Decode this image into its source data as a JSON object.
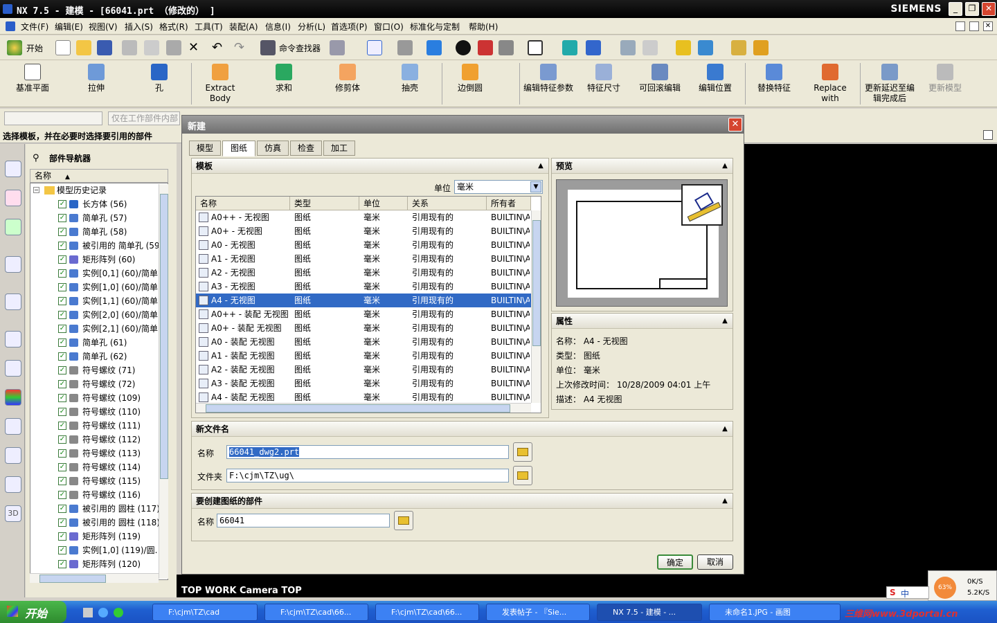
{
  "window": {
    "title": "NX 7.5 - 建模 - [66041.prt （修改的） ]",
    "brand": "SIEMENS"
  },
  "menu": [
    "文件(F)",
    "编辑(E)",
    "视图(V)",
    "插入(S)",
    "格式(R)",
    "工具(T)",
    "装配(A)",
    "信息(I)",
    "分析(L)",
    "首选项(P)",
    "窗口(O)",
    "标准化与定制",
    "帮助(H)"
  ],
  "toolbar1": {
    "start_label": "开始",
    "finder_label": "命令查找器"
  },
  "toolbar2": [
    "基准平面",
    "拉伸",
    "孔",
    "Extract Body",
    "求和",
    "修剪体",
    "抽壳",
    "边倒圆",
    "编辑特征参数",
    "特征尺寸",
    "可回滚编辑",
    "编辑位置",
    "替换特征",
    "Replace with",
    "更新延迟至编辑完成后",
    "更新模型"
  ],
  "filter": {
    "placeholder": "仅在工作部件内部"
  },
  "status": "选择模板，并在必要时选择要引用的部件",
  "navigator": {
    "title": "部件导航器",
    "col_name": "名称",
    "root": "模型历史记录",
    "items": [
      "长方体 (56)",
      "简单孔 (57)",
      "简单孔 (58)",
      "被引用的 简单孔 (59",
      "矩形阵列 (60)",
      "实例[0,1] (60)/简单.",
      "实例[1,0] (60)/简单.",
      "实例[1,1] (60)/简单.",
      "实例[2,0] (60)/简单.",
      "实例[2,1] (60)/简单.",
      "简单孔 (61)",
      "简单孔 (62)",
      "符号螺纹 (71)",
      "符号螺纹 (72)",
      "符号螺纹 (109)",
      "符号螺纹 (110)",
      "符号螺纹 (111)",
      "符号螺纹 (112)",
      "符号螺纹 (113)",
      "符号螺纹 (114)",
      "符号螺纹 (115)",
      "符号螺纹 (116)",
      "被引用的 圆柱 (117)",
      "被引用的 圆柱 (118)",
      "矩形阵列 (119)",
      "实例[1,0] (119)/圆.",
      "矩形阵列 (120)"
    ]
  },
  "dialog": {
    "title": "新建",
    "tabs": [
      "模型",
      "图纸",
      "仿真",
      "检查",
      "加工"
    ],
    "template": {
      "header": "模板",
      "unit_label": "单位",
      "unit_value": "毫米",
      "columns": [
        "名称",
        "类型",
        "单位",
        "关系",
        "所有者"
      ],
      "rows": [
        [
          "A0++ - 无视图",
          "图纸",
          "毫米",
          "引用现有的",
          "BUILTIN\\A"
        ],
        [
          "A0+ - 无视图",
          "图纸",
          "毫米",
          "引用现有的",
          "BUILTIN\\A"
        ],
        [
          "A0 - 无视图",
          "图纸",
          "毫米",
          "引用现有的",
          "BUILTIN\\A"
        ],
        [
          "A1 - 无视图",
          "图纸",
          "毫米",
          "引用现有的",
          "BUILTIN\\A"
        ],
        [
          "A2 - 无视图",
          "图纸",
          "毫米",
          "引用现有的",
          "BUILTIN\\A"
        ],
        [
          "A3 - 无视图",
          "图纸",
          "毫米",
          "引用现有的",
          "BUILTIN\\A"
        ],
        [
          "A4 - 无视图",
          "图纸",
          "毫米",
          "引用现有的",
          "BUILTIN\\A"
        ],
        [
          "A0++ - 装配 无视图",
          "图纸",
          "毫米",
          "引用现有的",
          "BUILTIN\\A"
        ],
        [
          "A0+ - 装配 无视图",
          "图纸",
          "毫米",
          "引用现有的",
          "BUILTIN\\A"
        ],
        [
          "A0 - 装配 无视图",
          "图纸",
          "毫米",
          "引用现有的",
          "BUILTIN\\A"
        ],
        [
          "A1 - 装配 无视图",
          "图纸",
          "毫米",
          "引用现有的",
          "BUILTIN\\A"
        ],
        [
          "A2 - 装配 无视图",
          "图纸",
          "毫米",
          "引用现有的",
          "BUILTIN\\A"
        ],
        [
          "A3 - 装配 无视图",
          "图纸",
          "毫米",
          "引用现有的",
          "BUILTIN\\A"
        ],
        [
          "A4 - 装配 无视图",
          "图纸",
          "毫米",
          "引用现有的",
          "BUILTIN\\A"
        ]
      ],
      "selected_index": 6
    },
    "preview": {
      "header": "预览"
    },
    "properties": {
      "header": "属性",
      "name_label": "名称：",
      "name": "A4 - 无视图",
      "type_label": "类型：",
      "type": "图纸",
      "unit_label": "单位：",
      "unit": "毫米",
      "modified_label": "上次修改时间：",
      "modified": "10/28/2009 04:01 上午",
      "desc_label": "描述：",
      "desc": "A4 无视图"
    },
    "newfile": {
      "header": "新文件名",
      "name_label": "名称",
      "name_value": "66041_dwg2.prt",
      "folder_label": "文件夹",
      "folder_value": "F:\\cjm\\TZ\\ug\\"
    },
    "part": {
      "header": "要创建图纸的部件",
      "name_label": "名称",
      "name_value": "66041"
    },
    "ok": "确定",
    "cancel": "取消"
  },
  "viewport": {
    "label": "TOP WORK Camera TOP"
  },
  "tray": {
    "cpu": "63%",
    "up": "0K/S",
    "down": "5.2K/S",
    "ime": "中"
  },
  "taskbar": {
    "start": "开始",
    "tasks": [
      "F:\\cjm\\TZ\\cad",
      "F:\\cjm\\TZ\\cad\\66...",
      "F:\\cjm\\TZ\\cad\\66...",
      "发表帖子 - 『Sie...",
      "NX 7.5 - 建模 - ...",
      "未命名1.JPG - 画图"
    ],
    "watermark": "三维网www.3dportal.cn"
  }
}
